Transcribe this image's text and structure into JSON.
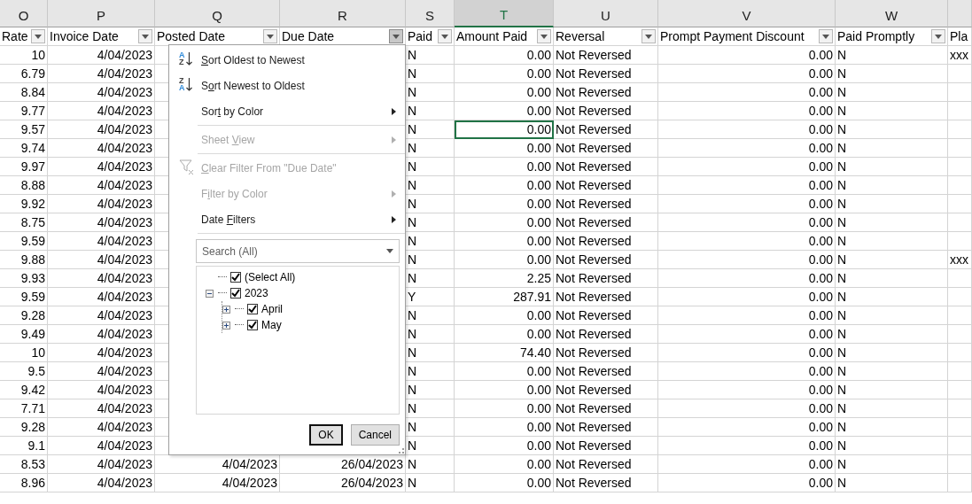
{
  "columns": [
    {
      "letter": "O",
      "header": "Rate",
      "kind": "number",
      "selected": false,
      "filter_open": false
    },
    {
      "letter": "P",
      "header": "Invoice Date",
      "kind": "number",
      "selected": false,
      "filter_open": false
    },
    {
      "letter": "Q",
      "header": "Posted Date",
      "kind": "number",
      "selected": false,
      "filter_open": false
    },
    {
      "letter": "R",
      "header": "Due Date",
      "kind": "number",
      "selected": false,
      "filter_open": true
    },
    {
      "letter": "S",
      "header": "Paid",
      "kind": "text",
      "selected": false,
      "filter_open": false
    },
    {
      "letter": "T",
      "header": "Amount Paid",
      "kind": "number",
      "selected": true,
      "filter_open": false
    },
    {
      "letter": "U",
      "header": "Reversal",
      "kind": "text",
      "selected": false,
      "filter_open": false
    },
    {
      "letter": "V",
      "header": "Prompt Payment Discount",
      "kind": "number",
      "selected": false,
      "filter_open": false
    },
    {
      "letter": "W",
      "header": "Paid Promptly",
      "kind": "text",
      "selected": false,
      "filter_open": false
    },
    {
      "header": "Pla",
      "kind": "text"
    }
  ],
  "rows": [
    {
      "active": false,
      "cells": [
        "10",
        "4/04/2023",
        null,
        null,
        "N",
        "0.00",
        "Not Reversed",
        "0.00",
        "N",
        "xxx"
      ]
    },
    {
      "active": false,
      "cells": [
        "6.79",
        "4/04/2023",
        null,
        null,
        "N",
        "0.00",
        "Not Reversed",
        "0.00",
        "N",
        null
      ]
    },
    {
      "active": false,
      "cells": [
        "8.84",
        "4/04/2023",
        null,
        null,
        "N",
        "0.00",
        "Not Reversed",
        "0.00",
        "N",
        null
      ]
    },
    {
      "active": false,
      "cells": [
        "9.77",
        "4/04/2023",
        null,
        null,
        "N",
        "0.00",
        "Not Reversed",
        "0.00",
        "N",
        null
      ]
    },
    {
      "active": true,
      "cells": [
        "9.57",
        "4/04/2023",
        null,
        null,
        "N",
        "0.00",
        "Not Reversed",
        "0.00",
        "N",
        null
      ]
    },
    {
      "active": false,
      "cells": [
        "9.74",
        "4/04/2023",
        null,
        null,
        "N",
        "0.00",
        "Not Reversed",
        "0.00",
        "N",
        null
      ]
    },
    {
      "active": false,
      "cells": [
        "9.97",
        "4/04/2023",
        null,
        null,
        "N",
        "0.00",
        "Not Reversed",
        "0.00",
        "N",
        null
      ]
    },
    {
      "active": false,
      "cells": [
        "8.88",
        "4/04/2023",
        null,
        null,
        "N",
        "0.00",
        "Not Reversed",
        "0.00",
        "N",
        null
      ]
    },
    {
      "active": false,
      "cells": [
        "9.92",
        "4/04/2023",
        null,
        null,
        "N",
        "0.00",
        "Not Reversed",
        "0.00",
        "N",
        null
      ]
    },
    {
      "active": false,
      "cells": [
        "8.75",
        "4/04/2023",
        null,
        null,
        "N",
        "0.00",
        "Not Reversed",
        "0.00",
        "N",
        null
      ]
    },
    {
      "active": false,
      "cells": [
        "9.59",
        "4/04/2023",
        null,
        null,
        "N",
        "0.00",
        "Not Reversed",
        "0.00",
        "N",
        null
      ]
    },
    {
      "active": false,
      "cells": [
        "9.88",
        "4/04/2023",
        null,
        null,
        "N",
        "0.00",
        "Not Reversed",
        "0.00",
        "N",
        "xxx"
      ]
    },
    {
      "active": false,
      "cells": [
        "9.93",
        "4/04/2023",
        null,
        null,
        "N",
        "2.25",
        "Not Reversed",
        "0.00",
        "N",
        null
      ]
    },
    {
      "active": false,
      "cells": [
        "9.59",
        "4/04/2023",
        null,
        null,
        "Y",
        "287.91",
        "Not Reversed",
        "0.00",
        "N",
        null
      ]
    },
    {
      "active": false,
      "cells": [
        "9.28",
        "4/04/2023",
        null,
        null,
        "N",
        "0.00",
        "Not Reversed",
        "0.00",
        "N",
        null
      ]
    },
    {
      "active": false,
      "cells": [
        "9.49",
        "4/04/2023",
        null,
        null,
        "N",
        "0.00",
        "Not Reversed",
        "0.00",
        "N",
        null
      ]
    },
    {
      "active": false,
      "cells": [
        "10",
        "4/04/2023",
        null,
        null,
        "N",
        "74.40",
        "Not Reversed",
        "0.00",
        "N",
        null
      ]
    },
    {
      "active": false,
      "cells": [
        "9.5",
        "4/04/2023",
        null,
        null,
        "N",
        "0.00",
        "Not Reversed",
        "0.00",
        "N",
        null
      ]
    },
    {
      "active": false,
      "cells": [
        "9.42",
        "4/04/2023",
        null,
        null,
        "N",
        "0.00",
        "Not Reversed",
        "0.00",
        "N",
        null
      ]
    },
    {
      "active": false,
      "cells": [
        "7.71",
        "4/04/2023",
        null,
        null,
        "N",
        "0.00",
        "Not Reversed",
        "0.00",
        "N",
        null
      ]
    },
    {
      "active": false,
      "cells": [
        "9.28",
        "4/04/2023",
        null,
        null,
        "N",
        "0.00",
        "Not Reversed",
        "0.00",
        "N",
        null
      ]
    },
    {
      "active": false,
      "cells": [
        "9.1",
        "4/04/2023",
        null,
        null,
        "N",
        "0.00",
        "Not Reversed",
        "0.00",
        "N",
        null
      ]
    },
    {
      "active": false,
      "cells": [
        "8.53",
        "4/04/2023",
        "4/04/2023",
        "26/04/2023",
        "N",
        "0.00",
        "Not Reversed",
        "0.00",
        "N",
        null
      ]
    },
    {
      "active": false,
      "cells": [
        "8.96",
        "4/04/2023",
        "4/04/2023",
        "26/04/2023",
        "N",
        "0.00",
        "Not Reversed",
        "0.00",
        "N",
        null
      ]
    }
  ],
  "filter_menu": {
    "items": [
      {
        "kind": "sort_ascending",
        "icon_letters": [
          "A",
          "Z"
        ],
        "label_parts": [
          {
            "text": "S",
            "underline": true
          },
          {
            "text": "ort Oldest to Newest",
            "underline": false
          }
        ],
        "disabled": false
      },
      {
        "kind": "sort_descending",
        "icon_letters": [
          "Z",
          "A"
        ],
        "label_parts": [
          {
            "text": "S",
            "underline": false
          },
          {
            "text": "o",
            "underline": true
          },
          {
            "text": "rt Newest to Oldest",
            "underline": false
          }
        ],
        "disabled": false
      },
      {
        "kind": "submenu",
        "label_parts": [
          {
            "text": "Sor",
            "underline": false
          },
          {
            "text": "t",
            "underline": true
          },
          {
            "text": " by Color",
            "underline": false
          }
        ],
        "disabled": false
      },
      {
        "kind": "separator"
      },
      {
        "kind": "submenu",
        "label_parts": [
          {
            "text": "Sheet ",
            "underline": false
          },
          {
            "text": "V",
            "underline": true
          },
          {
            "text": "iew",
            "underline": false
          }
        ],
        "disabled": true
      },
      {
        "kind": "separator"
      },
      {
        "kind": "clear_filter",
        "label_parts": [
          {
            "text": "C",
            "underline": true
          },
          {
            "text": "lear Filter From \"Due Date\"",
            "underline": false
          }
        ],
        "disabled": true
      },
      {
        "kind": "submenu",
        "label_parts": [
          {
            "text": "F",
            "underline": false
          },
          {
            "text": "i",
            "underline": true
          },
          {
            "text": "lter by Color",
            "underline": false
          }
        ],
        "disabled": true
      },
      {
        "kind": "submenu",
        "label_parts": [
          {
            "text": "Date ",
            "underline": false
          },
          {
            "text": "F",
            "underline": true
          },
          {
            "text": "ilters",
            "underline": false
          }
        ],
        "disabled": false
      },
      {
        "kind": "separator"
      }
    ],
    "search": {
      "placeholder": "Search (All)"
    },
    "tree": [
      {
        "label": "(Select All)",
        "checked": true
      },
      {
        "label": "2023",
        "checked": true,
        "expanded": true,
        "children": [
          {
            "label": "April",
            "checked": true,
            "expanded": false
          },
          {
            "label": "May",
            "checked": true,
            "expanded": false
          }
        ]
      }
    ],
    "buttons": [
      {
        "label": "OK",
        "default": true
      },
      {
        "label": "Cancel",
        "default": false
      }
    ]
  }
}
